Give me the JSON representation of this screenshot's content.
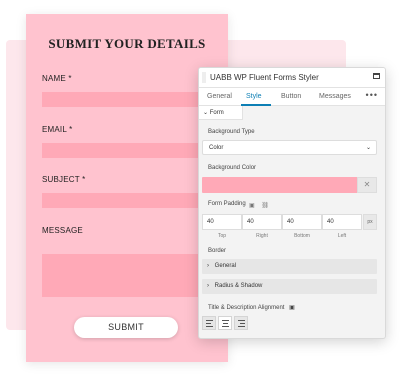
{
  "form": {
    "title": "SUBMIT YOUR DETAILS",
    "fields": [
      {
        "label": "NAME *"
      },
      {
        "label": "EMAIL *"
      },
      {
        "label": "SUBJECT *"
      },
      {
        "label": "MESSAGE"
      }
    ],
    "submit_label": "SUBMIT",
    "background_color": "#ffc3cf",
    "input_color": "#ffa9b7"
  },
  "panel": {
    "title": "UABB WP Fluent Forms Styler",
    "tabs": [
      {
        "label": "General",
        "active": false
      },
      {
        "label": "Style",
        "active": true
      },
      {
        "label": "Button",
        "active": false
      },
      {
        "label": "Messages",
        "active": false
      }
    ],
    "more_icon": "•••",
    "section_label": "Form",
    "background_type": {
      "label": "Background Type",
      "value": "Color"
    },
    "background_color": {
      "label": "Background Color",
      "value": "#ffa9b7",
      "clear_icon": "✕"
    },
    "form_padding": {
      "label": "Form Padding",
      "unit": "px",
      "values": [
        {
          "value": "40",
          "caption": "Top"
        },
        {
          "value": "40",
          "caption": "Right"
        },
        {
          "value": "40",
          "caption": "Bottom"
        },
        {
          "value": "40",
          "caption": "Left"
        }
      ]
    },
    "border_label": "Border",
    "rows": [
      {
        "label": "General"
      },
      {
        "label": "Radius & Shadow"
      }
    ],
    "alignment": {
      "label": "Title & Description Alignment",
      "options": [
        "left",
        "center",
        "right"
      ],
      "selected": "center"
    },
    "accent_color": "#0d7fb5"
  }
}
